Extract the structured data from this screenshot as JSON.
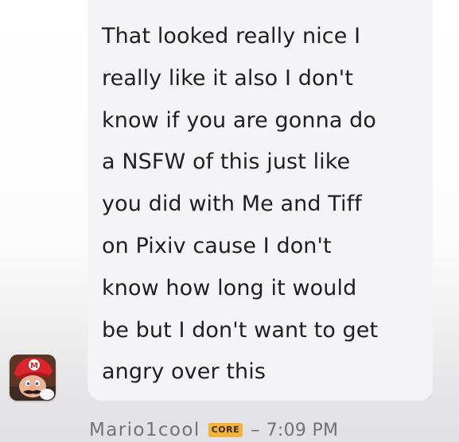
{
  "message": {
    "text": "That looked really nice I\nreally like it also I don't\nknow if you are gonna do\na NSFW of this just like\nyou did with Me and Tiff\non Pixiv cause I don't\nknow how long it would\nbe but I don't want to get\nangry over this",
    "author": "Mario1cool",
    "badge": "CORE",
    "separator": "–",
    "time": "7:09 PM",
    "avatar_icon": "mario-avatar-icon"
  },
  "colors": {
    "bubble": "#f4f4f6",
    "text": "#1f1f21",
    "meta_text": "#727276",
    "badge_bg": "#f2b33c"
  }
}
